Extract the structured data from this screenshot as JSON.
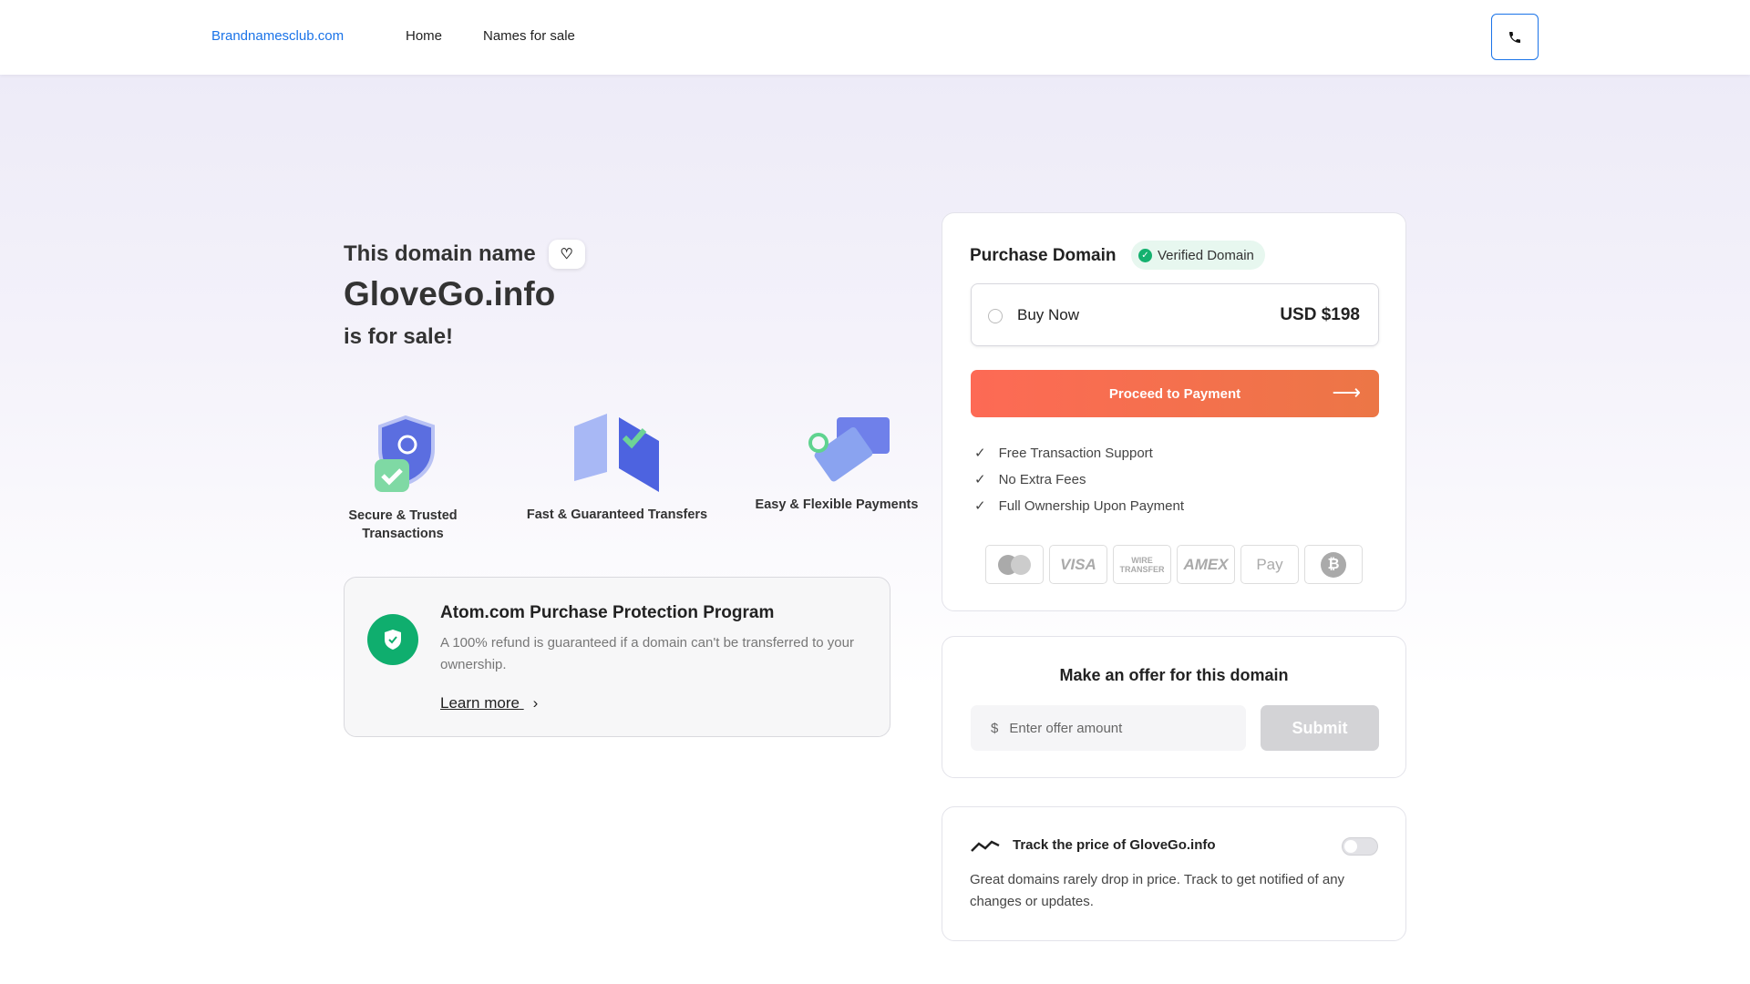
{
  "header": {
    "brand": "Brandnamesclub.com",
    "nav": [
      "Home",
      "Names for sale"
    ]
  },
  "hero": {
    "intro": "This domain name",
    "domain": "GloveGo.info",
    "suffix": "is for sale!"
  },
  "features": [
    {
      "label": "Secure & Trusted Transactions",
      "icon": "shield-check"
    },
    {
      "label": "Fast & Guaranteed Transfers",
      "icon": "transfer-windows"
    },
    {
      "label": "Easy & Flexible Payments",
      "icon": "cards"
    }
  ],
  "protection": {
    "title": "Atom.com Purchase Protection Program",
    "text": "A 100% refund is guaranteed if a domain can't be transferred to your ownership.",
    "link": "Learn more"
  },
  "purchase": {
    "title": "Purchase Domain",
    "badge": "Verified Domain",
    "option": "Buy Now",
    "price": "USD $198",
    "button": "Proceed to Payment",
    "benefits": [
      "Free Transaction Support",
      "No Extra Fees",
      "Full Ownership Upon Payment"
    ],
    "payments": [
      "mastercard",
      "VISA",
      "WIRE TRANSFER",
      "AMEX",
      "Pay",
      "bitcoin"
    ],
    "accent": "#f96a50"
  },
  "offer": {
    "title": "Make an offer for this domain",
    "currency": "$",
    "placeholder": "Enter offer amount",
    "submit": "Submit"
  },
  "track": {
    "title": "Track the price of GloveGo.info",
    "text": "Great domains rarely drop in price. Track to get notified of any changes or updates.",
    "enabled": false
  }
}
